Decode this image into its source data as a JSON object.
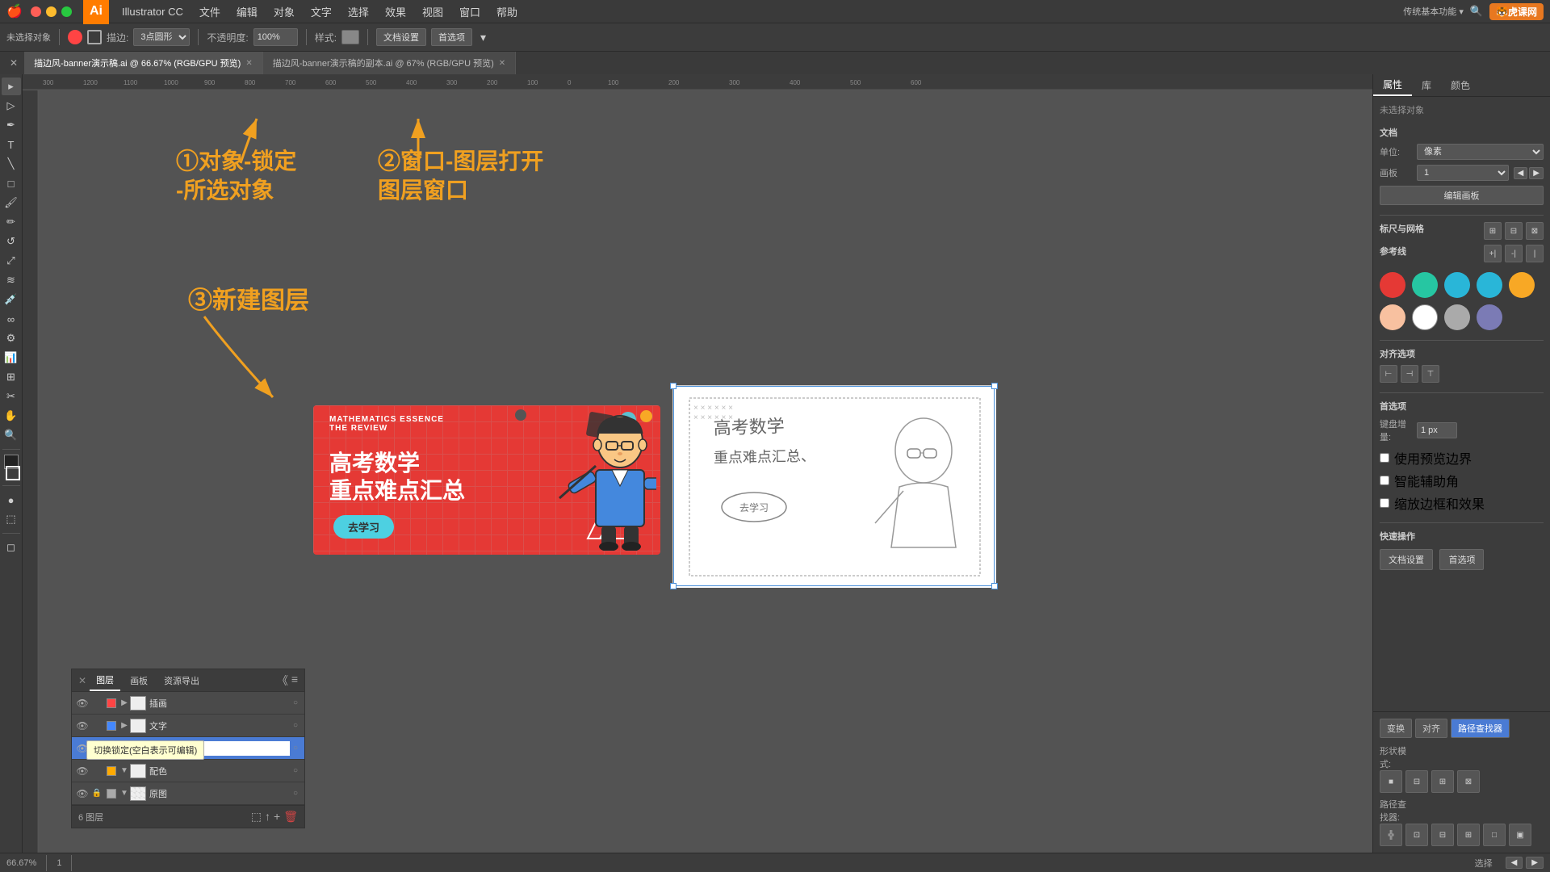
{
  "app": {
    "name": "Illustrator CC",
    "ai_logo": "Ai",
    "version": "CC"
  },
  "menubar": {
    "apple": "🍎",
    "items": [
      "Illustrator CC",
      "文件",
      "编辑",
      "对象",
      "文字",
      "选择",
      "效果",
      "视图",
      "窗口",
      "帮助"
    ]
  },
  "toolbar": {
    "no_select_label": "未选择对象",
    "stroke_label": "描边:",
    "stroke_value": "3点圆形",
    "opacity_label": "不透明度:",
    "opacity_value": "100%",
    "style_label": "样式:",
    "doc_settings": "文档设置",
    "preferences": "首选项"
  },
  "tabs": [
    {
      "name": "描边风-banner演示稿.ai",
      "detail": "66.67% (RGB/GPU 预览)",
      "active": true
    },
    {
      "name": "描边风-banner演示稿的副本.ai",
      "detail": "67% (RGB/GPU 预览)",
      "active": false
    }
  ],
  "annotations": {
    "ann1_text": "①对象-锁定\n-所选对象",
    "ann2_text": "②窗口-图层打开\n图层窗口",
    "ann3_text": "③新建图层",
    "arr1_direction": "up-left",
    "arr2_direction": "up",
    "arr3_direction": "down-right"
  },
  "layers_panel": {
    "tabs": [
      "图层",
      "画板",
      "资源导出"
    ],
    "layers": [
      {
        "name": "插画",
        "visible": true,
        "locked": false,
        "color": "#ff0000",
        "expanded": false,
        "target": true
      },
      {
        "name": "文字",
        "visible": true,
        "locked": false,
        "color": "#0000ff",
        "expanded": false,
        "target": true
      },
      {
        "name": "",
        "visible": true,
        "locked": false,
        "color": "#00aaff",
        "expanded": false,
        "editing": true,
        "active": true
      },
      {
        "name": "配色",
        "visible": true,
        "locked": false,
        "color": "#ffaa00",
        "expanded": true,
        "target": false
      },
      {
        "name": "原图",
        "visible": true,
        "locked": true,
        "color": "#aaaaaa",
        "expanded": true,
        "target": false
      }
    ],
    "layer_count": "6 图层",
    "tooltip": "切换锁定(空白表示可编辑)"
  },
  "right_panel": {
    "tabs": [
      "属性",
      "库",
      "颜色"
    ],
    "active_tab": "属性",
    "no_select_text": "未选择对象",
    "doc_section": "文档",
    "unit_label": "单位:",
    "unit_value": "像素",
    "artboard_label": "画板",
    "artboard_value": "1",
    "edit_artboard_btn": "编辑画板",
    "rulers_label": "标尺与网格",
    "guides_label": "参考线",
    "align_label": "对齐选项",
    "preferences_label": "首选项",
    "nudge_label": "键盘增量:",
    "nudge_value": "1 px",
    "use_preview_bounds": "使用预览边界",
    "smart_guides": "智能辅助角",
    "snap_label": "缩放边框和效果",
    "quick_actions": "快速操作",
    "doc_settings_btn": "文档设置",
    "preferences_btn": "首选项"
  },
  "right_bottom": {
    "tabs": [
      "变换",
      "对齐",
      "路径查找器"
    ],
    "active_tab": "路径查找器",
    "shape_modes_label": "形状模式:",
    "pathfinders_label": "路径查找器:"
  },
  "colors": {
    "swatches": [
      "#e53935",
      "#26c6a2",
      "#29b6d8",
      "#29b6d8",
      "#f8a825",
      "#f8c1a0",
      "#ffffff",
      "#aaaaaa",
      "#7b7bb5"
    ]
  },
  "banner": {
    "eng_line1": "MATHEMATICS ESSENCE",
    "eng_line2": "THE REVIEW",
    "cn_line1": "高考数学",
    "cn_line2": "重点难点汇总",
    "btn_text": "去学习",
    "bg_color": "#e53935"
  },
  "bottom_bar": {
    "zoom": "66.67%",
    "artboard": "1",
    "tool": "选择"
  }
}
